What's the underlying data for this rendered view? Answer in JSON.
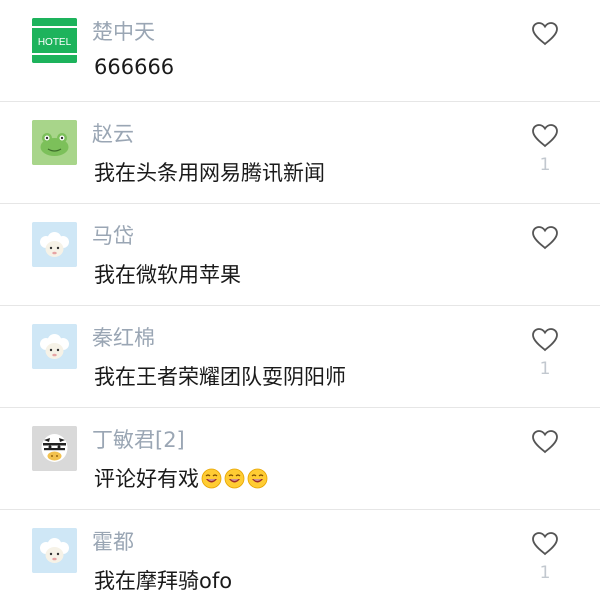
{
  "comments": [
    {
      "username": "楚中天",
      "text": "666666",
      "likes": "",
      "avatar": "hotel-logo",
      "avatar_text": "HOTEL",
      "avatar_color": "#1db35c"
    },
    {
      "username": "赵云",
      "text": "我在头条用网易腾讯新闻",
      "likes": "1",
      "avatar": "frog",
      "avatar_color": "#a8d58a"
    },
    {
      "username": "马岱",
      "text": "我在微软用苹果",
      "likes": "",
      "avatar": "sheep",
      "avatar_color": "#cfe7f6"
    },
    {
      "username": "秦红棉",
      "text": "我在王者荣耀团队耍阴阳师",
      "likes": "1",
      "avatar": "sheep",
      "avatar_color": "#cfe7f6"
    },
    {
      "username": "丁敏君[2]",
      "text": "评论好有戏",
      "likes": "",
      "avatar": "zebra",
      "avatar_color": "#d9d9d9",
      "emojis": [
        "laughing-emoji",
        "laughing-emoji",
        "laughing-emoji"
      ]
    },
    {
      "username": "霍都",
      "text": "我在摩拜骑ofo",
      "likes": "1",
      "avatar": "sheep",
      "avatar_color": "#cfe7f6"
    }
  ],
  "colors": {
    "username": "#9aa6b4",
    "comment": "#1a1a1a",
    "like_outline": "#555555",
    "like_count": "#c2c8cf"
  },
  "icons": {
    "like": "heart-outline-icon"
  }
}
